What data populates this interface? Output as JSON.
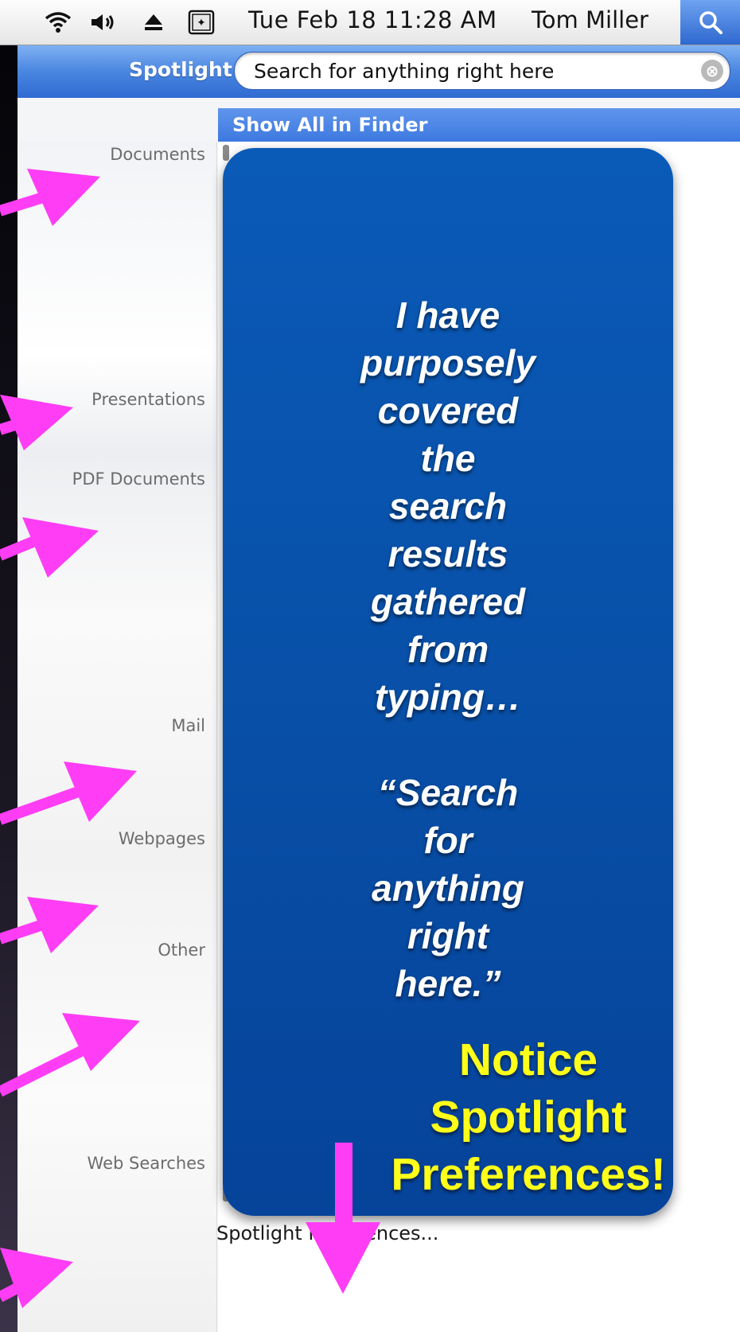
{
  "menubar": {
    "clock": "Tue Feb 18  11:28 AM",
    "user": "Tom Miller",
    "icons": [
      "wifi-icon",
      "volume-icon",
      "eject-icon",
      "keyboard-input-icon",
      "spotlight-search-icon"
    ]
  },
  "spotlight": {
    "title": "Spotlight",
    "search_value": "Search for anything right here",
    "clear_icon": "⊗",
    "show_all": "Show All in Finder",
    "preferences": "Spotlight Preferences..."
  },
  "categories": [
    "Documents",
    "Presentations",
    "PDF Documents",
    "Mail",
    "Webpages",
    "Other",
    "Web Searches"
  ],
  "overlay": {
    "lines": [
      "I have",
      "purposely",
      "covered",
      "the",
      "search",
      "results",
      "gathered",
      "from",
      "typing…",
      "",
      "“Search",
      "for",
      "anything",
      "right",
      "here.”"
    ],
    "notice": [
      "Notice",
      "Spotlight",
      "Preferences!"
    ]
  },
  "colors": {
    "accent_blue": "#3d79e0",
    "overlay_blue": "#0850a8",
    "arrow_magenta": "#ff3df5",
    "notice_yellow": "#ffff1a"
  }
}
